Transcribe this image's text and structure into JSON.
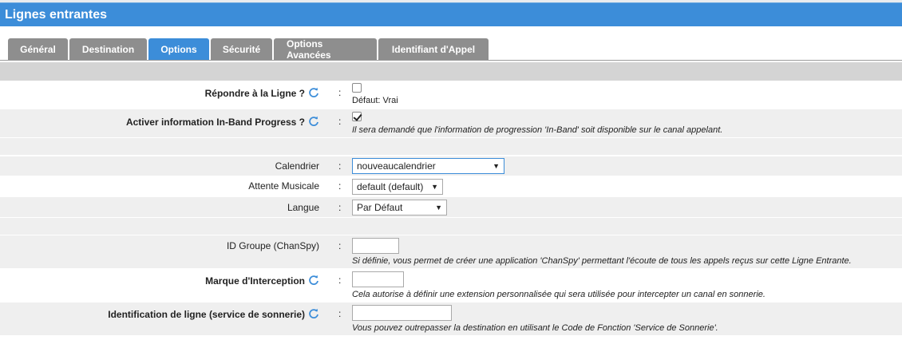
{
  "header": {
    "title": "Lignes entrantes"
  },
  "tabs": [
    {
      "label": "Général"
    },
    {
      "label": "Destination"
    },
    {
      "label": "Options"
    },
    {
      "label": "Sécurité"
    },
    {
      "label": "Options Avancées"
    },
    {
      "label": "Identifiant d'Appel"
    }
  ],
  "options": {
    "answer": {
      "label": "Répondre à la Ligne ?",
      "checked": false,
      "default_text": "Défaut: Vrai"
    },
    "inband": {
      "label": "Activer information In-Band Progress ?",
      "checked": true,
      "desc": "Il sera demandé que l'information de progression 'In-Band' soit disponible sur le canal appelant."
    },
    "calendar": {
      "label": "Calendrier",
      "value": "nouveaucalendrier"
    },
    "moh": {
      "label": "Attente Musicale",
      "value": "default (default)"
    },
    "language": {
      "label": "Langue",
      "value": "Par Défaut"
    },
    "chanspy": {
      "label": "ID Groupe (ChanSpy)",
      "value": "",
      "desc": "Si définie, vous permet de créer une application 'ChanSpy' permettant l'écoute de tous les appels reçus sur cette Ligne Entrante."
    },
    "intercept": {
      "label": "Marque d'Interception",
      "value": "",
      "desc": "Cela autorise à définir une extension personnalisée qui sera utilisée pour intercepter un canal en sonnerie."
    },
    "ringservice": {
      "label": "Identification de ligne (service de sonnerie)",
      "value": "",
      "desc": "Vous pouvez outrepasser la destination en utilisant le Code de Fonction 'Service de Sonnerie'."
    }
  },
  "colon": ":",
  "colors": {
    "accent": "#3c8dd9",
    "tab_inactive": "#8e8e8e",
    "row_grey": "#efefef"
  }
}
